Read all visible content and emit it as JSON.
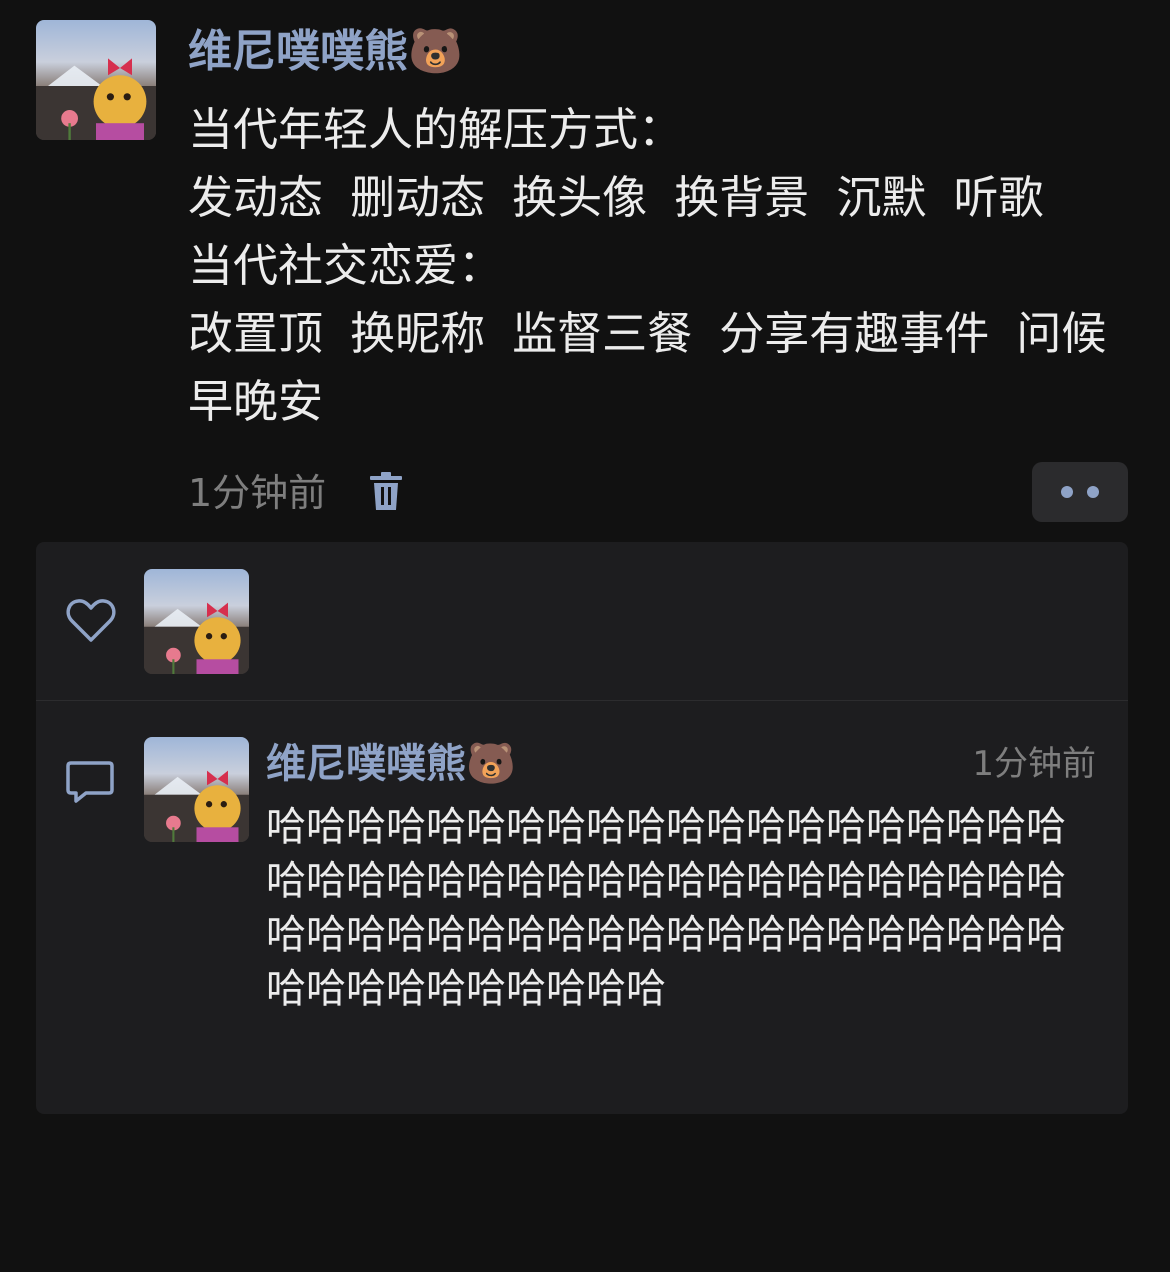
{
  "post": {
    "author": "维尼噗噗熊🐻",
    "text": "当代年轻人的解压方式：\n发动态 删动态 换头像 换背景 沉默 听歌\n当代社交恋爱：\n改置顶 换昵称 监督三餐 分享有趣事件 问候早晚安",
    "time": "1分钟前"
  },
  "comment": {
    "author": "维尼噗噗熊🐻",
    "time": "1分钟前",
    "text": "哈哈哈哈哈哈哈哈哈哈哈哈哈哈哈哈哈哈哈哈哈哈哈哈哈哈哈哈哈哈哈哈哈哈哈哈哈哈哈哈哈哈哈哈哈哈哈哈哈哈哈哈哈哈哈哈哈哈哈哈哈哈哈哈哈哈哈哈哈哈"
  },
  "icons": {
    "delete": "trash-icon",
    "more": "more-dots-icon",
    "like": "heart-outline-icon",
    "comment": "comment-bubble-icon"
  },
  "colors": {
    "background": "#111111",
    "panel": "#1d1d1f",
    "name": "#8fa3c7",
    "text": "#ececec",
    "muted": "#7e7e7e"
  }
}
